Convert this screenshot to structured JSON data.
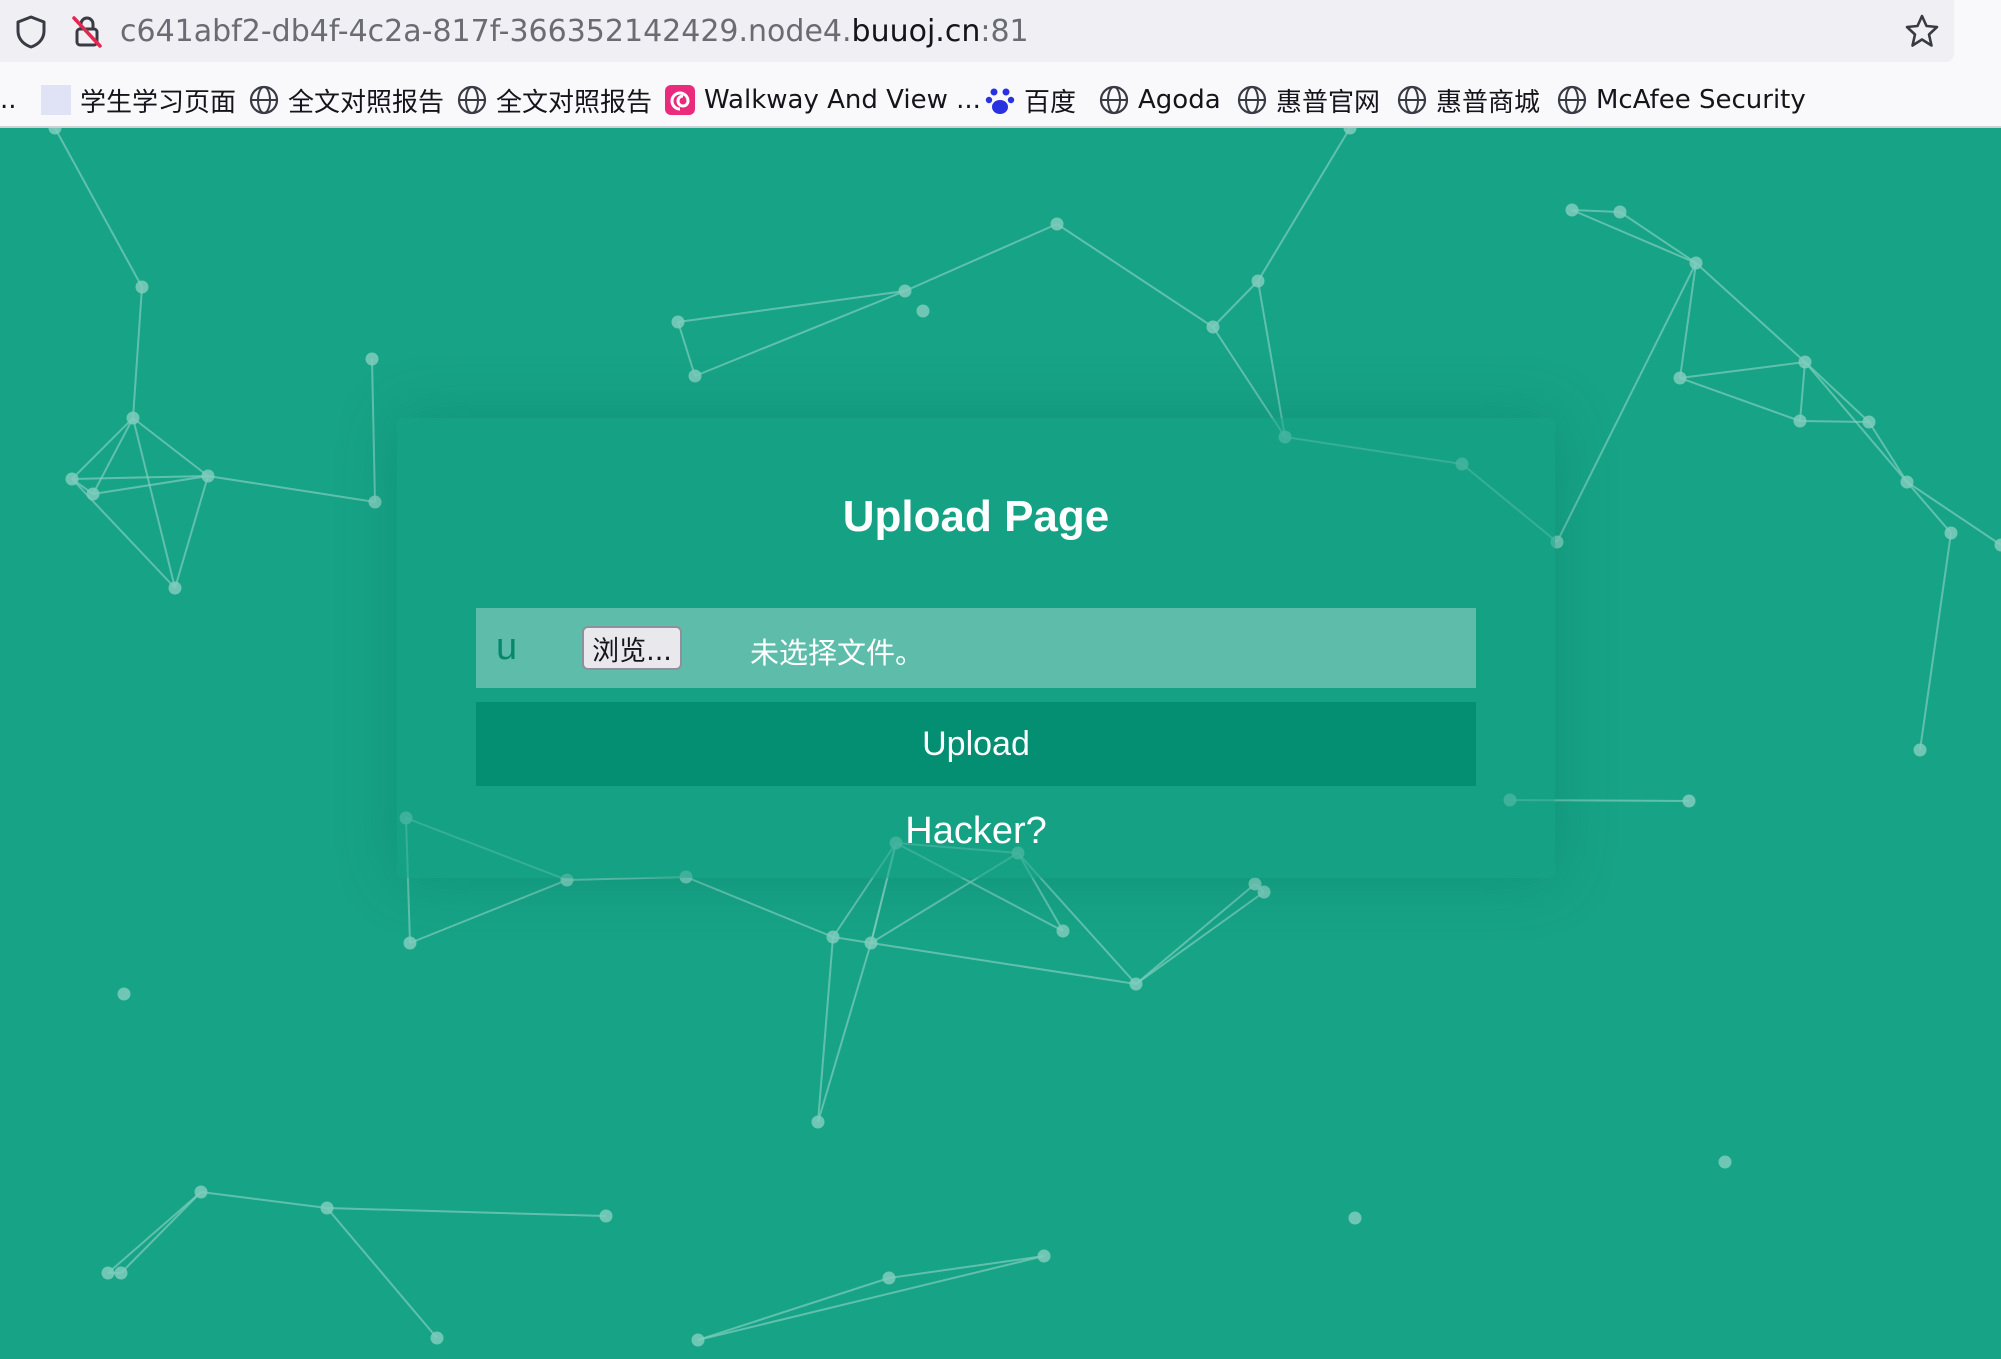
{
  "browser": {
    "url_prefix": "c641abf2-db4f-4c2a-817f-366352142429.node4.",
    "url_host": "buuoj.cn",
    "url_suffix": ":81",
    "bookmarks_overflow": "..",
    "bookmarks": [
      {
        "label": "学生学习页面",
        "icon": "page-icon"
      },
      {
        "label": "全文对照报告",
        "icon": "globe-icon"
      },
      {
        "label": "全文对照报告",
        "icon": "globe-icon"
      },
      {
        "label": "Walkway And View ...",
        "icon": "swirl-logo-icon"
      },
      {
        "label": "百度",
        "icon": "paw-icon"
      },
      {
        "label": "Agoda",
        "icon": "globe-icon"
      },
      {
        "label": "惠普官网",
        "icon": "globe-icon"
      },
      {
        "label": "惠普商城",
        "icon": "globe-icon"
      },
      {
        "label": "McAfee Security",
        "icon": "globe-icon"
      }
    ]
  },
  "page": {
    "title": "Upload Page",
    "file_prefix": "u",
    "browse_label": "浏览...",
    "file_status": "未选择文件。",
    "upload_label": "Upload",
    "hacker_link": "Hacker?"
  },
  "colors": {
    "background": "#17a386",
    "panel": "#1aa084",
    "file_row": "#5dbdaa",
    "upload_button": "#048e72",
    "particles": "#7fcdbd"
  }
}
